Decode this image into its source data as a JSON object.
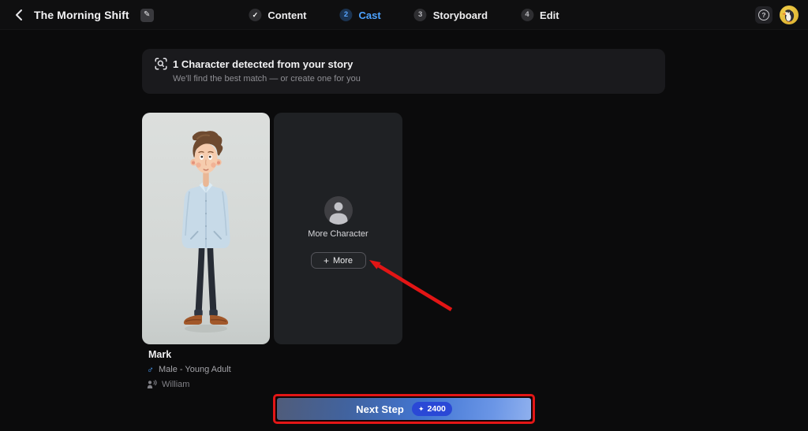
{
  "topbar": {
    "title": "The Morning Shift",
    "edit_icon": "✎",
    "help_icon": "?",
    "steps": [
      {
        "marker": "✓",
        "label": "Content",
        "state": "done"
      },
      {
        "marker": "2",
        "label": "Cast",
        "state": "active"
      },
      {
        "marker": "3",
        "label": "Storyboard",
        "state": "pending"
      },
      {
        "marker": "4",
        "label": "Edit",
        "state": "pending"
      }
    ]
  },
  "banner": {
    "title": "1 Character detected from your story",
    "subtitle": "We'll find the best match — or create one for you"
  },
  "cast": {
    "character": {
      "name": "Mark",
      "gender_icon": "♂",
      "demographic": "Male - Young Adult",
      "voice_name": "William"
    },
    "more_card": {
      "label": "More Character",
      "plus_icon": "+",
      "button_label": "More"
    }
  },
  "footer": {
    "next_step_label": "Next Step",
    "credit_icon": "✦",
    "credit_amount": "2400"
  },
  "annotations": {
    "highlight_color": "#e31616",
    "arrow_points_to": "more-button",
    "rectangle_around": "next-step-button"
  },
  "colors": {
    "accent_blue": "#4da3ff",
    "badge_blue": "#2a48d6",
    "annotation_red": "#e31616",
    "avatar_yellow": "#e9c53d"
  }
}
